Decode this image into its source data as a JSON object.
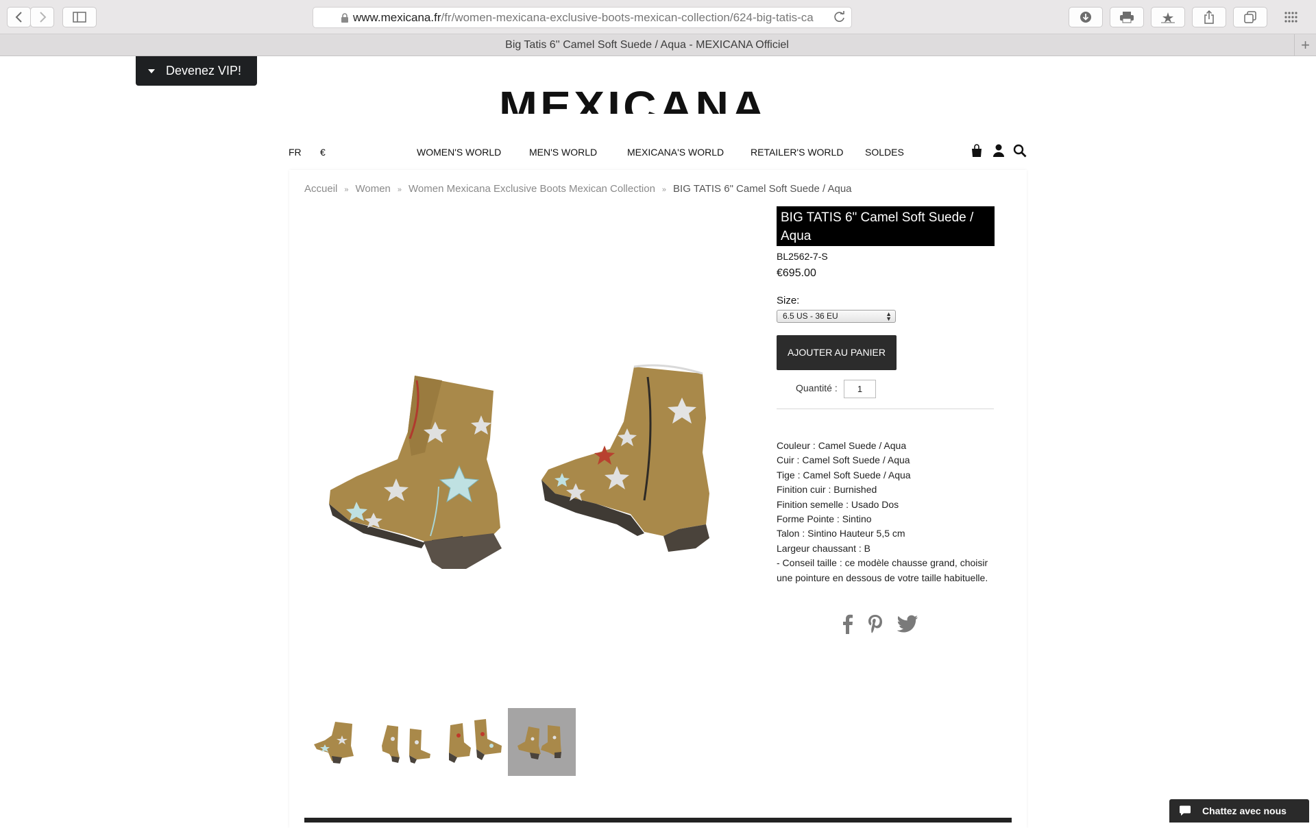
{
  "browser": {
    "url_host": "www.mexicana.fr",
    "url_path": "/fr/women-mexicana-exclusive-boots-mexican-collection/624-big-tatis-ca",
    "tab_title": "Big Tatis 6'' Camel Soft Suede / Aqua - MEXICANA Officiel",
    "new_tab": "+"
  },
  "vip": {
    "label": "Devenez VIP!"
  },
  "logo": {
    "text": "MEXICANA"
  },
  "nav": {
    "lang": "FR",
    "currency": "€",
    "items": [
      "WOMEN'S WORLD",
      "MEN'S WORLD",
      "MEXICANA'S WORLD",
      "RETAILER'S WORLD",
      "SOLDES"
    ]
  },
  "breadcrumb": [
    "Accueil",
    "Women",
    "Women Mexicana Exclusive Boots Mexican Collection",
    "BIG TATIS 6\" Camel Soft Suede / Aqua"
  ],
  "breadcrumb_sep": "»",
  "product": {
    "title": "BIG TATIS 6\" Camel Soft Suede / Aqua",
    "sku": "BL2562-7-S",
    "price": "€695.00",
    "size_label": "Size:",
    "size_value": "6.5 US - 36 EU",
    "add_to_cart": "AJOUTER AU PANIER",
    "qty_label": "Quantité :",
    "qty_value": "1",
    "description": [
      "Couleur : Camel Suede / Aqua",
      "Cuir : Camel Soft Suede / Aqua",
      "Tige : Camel Soft Suede / Aqua",
      "Finition cuir : Burnished",
      "Finition semelle : Usado Dos",
      "Forme Pointe : Sintino",
      "Talon : Sintino Hauteur 5,5 cm",
      "Largeur chaussant : B",
      "- Conseil taille : ce modèle chausse grand, choisir",
      "une pointure en dessous de votre taille habituelle."
    ]
  },
  "chat": {
    "label": "Chattez avec nous"
  },
  "colors": {
    "boot_suede": "#a9894a",
    "boot_heel": "#4a433b",
    "accent_black": "#000000"
  }
}
